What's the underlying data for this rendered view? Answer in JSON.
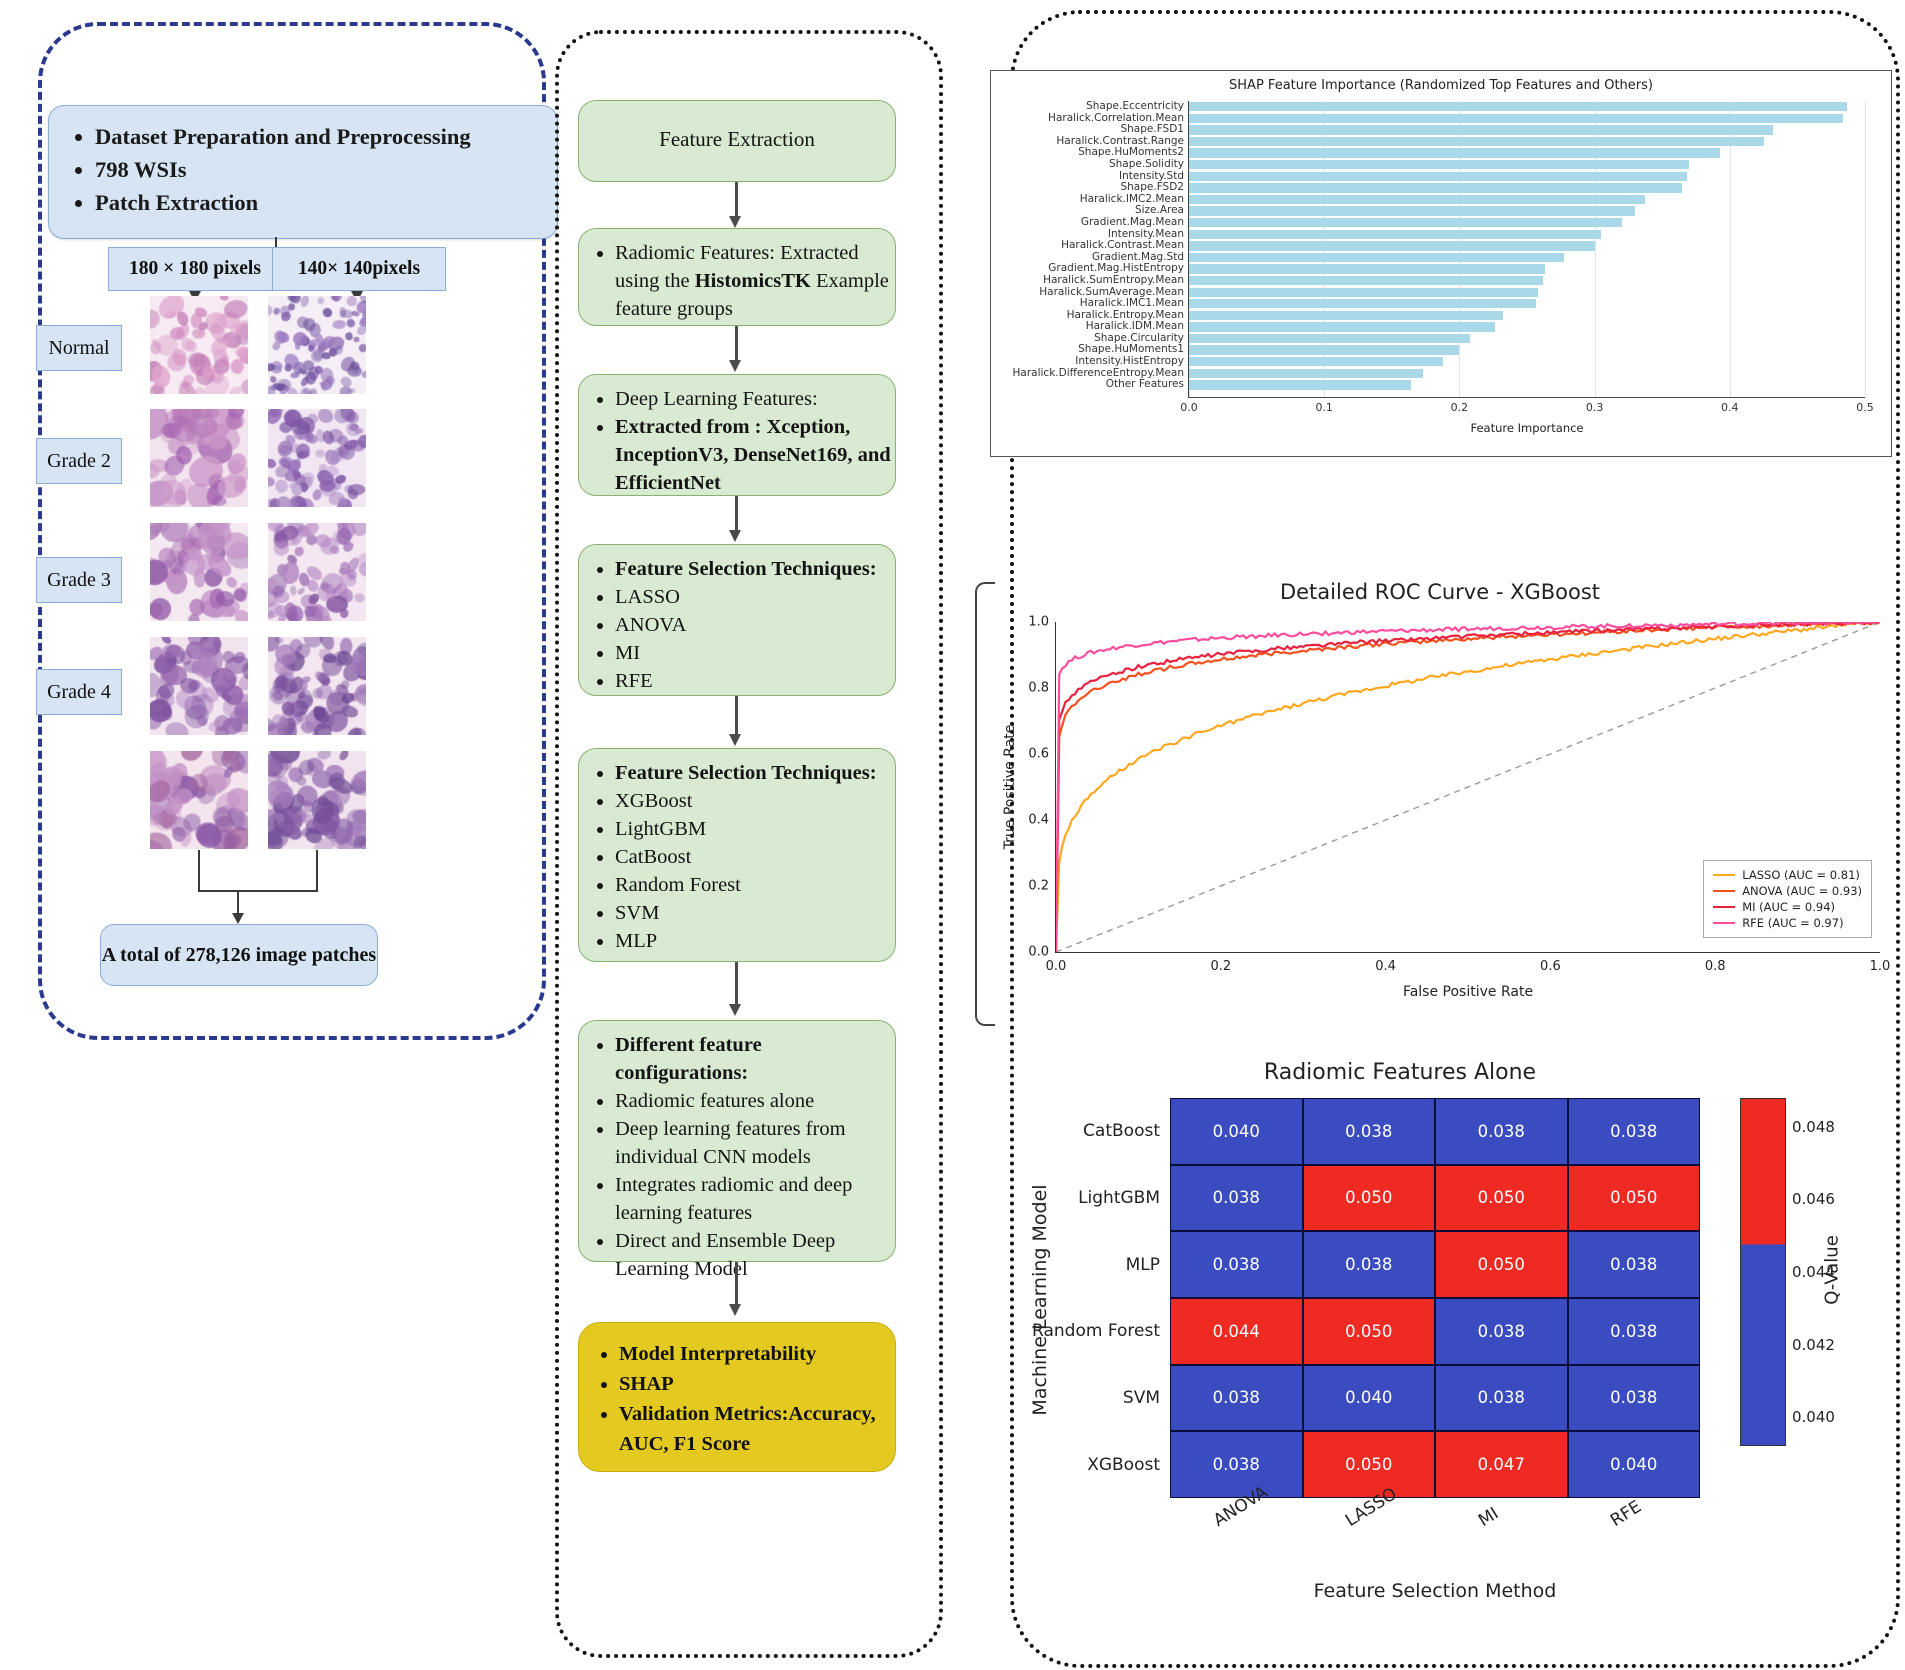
{
  "left_panel": {
    "dataset_box": {
      "items": [
        "Dataset Preparation and Preprocessing",
        "798 WSIs",
        "Patch Extraction"
      ]
    },
    "patch_sizes": [
      "180 × 180 pixels",
      "140× 140pixels"
    ],
    "grades": [
      "Normal",
      "Grade 2",
      "Grade 3",
      "Grade 4"
    ],
    "total_box": "A total of 278,126 image patches"
  },
  "mid_panel": {
    "boxes": [
      {
        "type": "plain",
        "title": "Feature Extraction"
      },
      {
        "type": "list",
        "items_html": [
          "Radiomic Features: Extracted using the <b>HistomicsTK</b> Example feature groups"
        ]
      },
      {
        "type": "list",
        "items_html": [
          "Deep Learning Features:",
          "<b>Extracted from : Xception, InceptionV3, DenseNet169, and EfficientNet</b>"
        ]
      },
      {
        "type": "list",
        "items_html": [
          "<b>Feature Selection Techniques:</b>",
          "LASSO",
          "ANOVA",
          "MI",
          "RFE"
        ]
      },
      {
        "type": "list",
        "items_html": [
          "<b>Feature Selection Techniques:</b>",
          "XGBoost",
          "LightGBM",
          "CatBoost",
          "Random Forest",
          "SVM",
          "MLP"
        ]
      },
      {
        "type": "list",
        "items_html": [
          "<b>Different feature configurations:</b>",
          "Radiomic features alone",
          " Deep learning features from individual CNN models",
          " Integrates radiomic and deep learning features",
          "Direct and Ensemble Deep Learning Model"
        ]
      }
    ],
    "final_box": {
      "items": [
        "Model Interpretability",
        "SHAP",
        "Validation Metrics:Accuracy, AUC, F1 Score"
      ]
    }
  },
  "chart_data": [
    {
      "type": "bar",
      "orientation": "horizontal",
      "title": "SHAP Feature Importance (Randomized Top Features and Others)",
      "xlabel": "Feature Importance",
      "ylabel": "",
      "xlim": [
        0.0,
        0.5
      ],
      "xticks": [
        0.0,
        0.1,
        0.2,
        0.3,
        0.4,
        0.5
      ],
      "xticklabels": [
        "0.0",
        "0.1",
        "0.2",
        "0.3",
        "0.4",
        "0.5"
      ],
      "grid": true,
      "bar_color": "#a9d8e8",
      "categories": [
        "Shape.Eccentricity",
        "Haralick.Correlation.Mean",
        "Shape.FSD1",
        "Haralick.Contrast.Range",
        "Shape.HuMoments2",
        "Shape.Solidity",
        "Intensity.Std",
        "Shape.FSD2",
        "Haralick.IMC2.Mean",
        "Size.Area",
        "Gradient.Mag.Mean",
        "Intensity.Mean",
        "Haralick.Contrast.Mean",
        "Gradient.Mag.Std",
        "Gradient.Mag.HistEntropy",
        "Haralick.SumEntropy.Mean",
        "Haralick.SumAverage.Mean",
        "Haralick.IMC1.Mean",
        "Haralick.Entropy.Mean",
        "Haralick.IDM.Mean",
        "Shape.Circularity",
        "Shape.HuMoments1",
        "Intensity.HistEntropy",
        "Haralick.DifferenceEntropy.Mean",
        "Other Features"
      ],
      "values": [
        0.487,
        0.484,
        0.432,
        0.425,
        0.393,
        0.37,
        0.368,
        0.365,
        0.337,
        0.33,
        0.32,
        0.305,
        0.3,
        0.277,
        0.263,
        0.262,
        0.258,
        0.257,
        0.232,
        0.226,
        0.208,
        0.2,
        0.188,
        0.173,
        0.164
      ]
    },
    {
      "type": "line",
      "title": "Detailed ROC Curve - XGBoost",
      "xlabel": "False Positive Rate",
      "ylabel": "True Positive Rate",
      "xlim": [
        0.0,
        1.0
      ],
      "ylim": [
        0.0,
        1.0
      ],
      "xticks": [
        0.0,
        0.2,
        0.4,
        0.6,
        0.8,
        1.0
      ],
      "xticklabels": [
        "0.0",
        "0.2",
        "0.4",
        "0.6",
        "0.8",
        "1.0"
      ],
      "yticks": [
        0.0,
        0.2,
        0.4,
        0.6,
        0.8,
        1.0
      ],
      "yticklabels": [
        "0.0",
        "0.2",
        "0.4",
        "0.6",
        "0.8",
        "1.0"
      ],
      "legend_position": "lower right",
      "diagonal_reference": true,
      "series": [
        {
          "name": "LASSO (AUC = 0.81)",
          "auc": 0.81,
          "color": "#ffa81f"
        },
        {
          "name": "ANOVA (AUC = 0.93)",
          "auc": 0.93,
          "color": "#f4511e"
        },
        {
          "name": "MI (AUC = 0.94)",
          "auc": 0.94,
          "color": "#e8213f"
        },
        {
          "name": "RFE (AUC = 0.97)",
          "auc": 0.97,
          "color": "#ff4d9e"
        }
      ]
    },
    {
      "type": "heatmap",
      "title": "Radiomic Features Alone",
      "xlabel": "Feature Selection Method",
      "ylabel": "Machine Learning Model",
      "colorbar_label": "Q-Value",
      "colorbar_ticks": [
        "0.048",
        "0.046",
        "0.044",
        "0.042",
        "0.040"
      ],
      "colorbar_low_color": "#3b4cc0",
      "colorbar_high_color": "#ee2a22",
      "columns": [
        "ANOVA",
        "LASSO",
        "MI",
        "RFE"
      ],
      "rows": [
        "CatBoost",
        "LightGBM",
        "MLP",
        "Random Forest",
        "SVM",
        "XGBoost"
      ],
      "values": [
        [
          "0.040",
          "0.038",
          "0.038",
          "0.038"
        ],
        [
          "0.038",
          "0.050",
          "0.050",
          "0.050"
        ],
        [
          "0.038",
          "0.038",
          "0.050",
          "0.038"
        ],
        [
          "0.044",
          "0.050",
          "0.038",
          "0.038"
        ],
        [
          "0.038",
          "0.040",
          "0.038",
          "0.038"
        ],
        [
          "0.038",
          "0.050",
          "0.047",
          "0.040"
        ]
      ]
    }
  ]
}
